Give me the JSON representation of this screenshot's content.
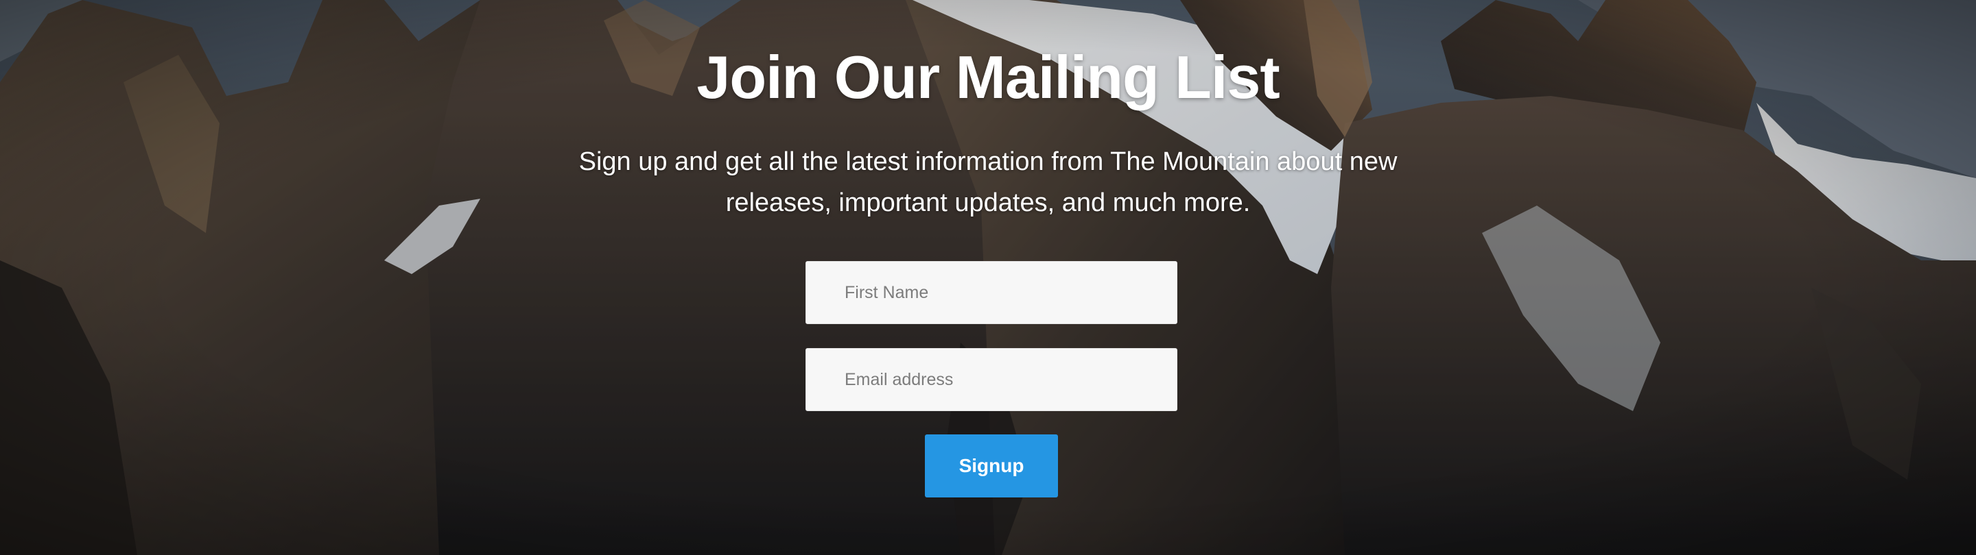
{
  "mailing": {
    "title": "Join Our Mailing List",
    "subtitle": "Sign up and get all the latest information from The Mountain about new releases, important updates, and much more.",
    "first_name_placeholder": "First Name",
    "email_placeholder": "Email address",
    "signup_label": "Signup"
  },
  "colors": {
    "button": "#2596e3",
    "field_background": "#f7f7f7",
    "text": "#ffffff"
  },
  "background": {
    "description_icon": "mountain-range-image"
  }
}
